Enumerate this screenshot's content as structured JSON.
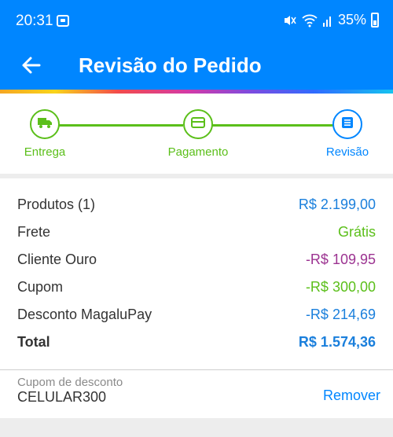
{
  "status_bar": {
    "time": "20:31",
    "battery_percent": "35%",
    "icons": [
      "notification-icon",
      "mute-icon",
      "wifi-icon",
      "signal-icon",
      "battery-icon"
    ]
  },
  "app_bar": {
    "title": "Revisão do Pedido",
    "back_icon": "arrow-left-icon"
  },
  "colors": {
    "primary": "#0086ff",
    "green": "#5bbf1a",
    "purple": "#9c3391",
    "text": "#333333"
  },
  "stepper": {
    "steps": [
      {
        "label": "Entrega",
        "icon": "truck-icon",
        "state": "done"
      },
      {
        "label": "Pagamento",
        "icon": "card-icon",
        "state": "done"
      },
      {
        "label": "Revisão",
        "icon": "list-icon",
        "state": "active"
      }
    ]
  },
  "summary": {
    "rows": [
      {
        "label": "Produtos (1)",
        "value": "R$ 2.199,00",
        "color": "#1a7fdc"
      },
      {
        "label": "Frete",
        "value": "Grátis",
        "color": "#5bbf1a"
      },
      {
        "label": "Cliente Ouro",
        "value": "-R$ 109,95",
        "color": "#9c3391"
      },
      {
        "label": "Cupom",
        "value": "-R$ 300,00",
        "color": "#5bbf1a"
      },
      {
        "label": "Desconto MagaluPay",
        "value": "-R$ 214,69",
        "color": "#1a7fdc"
      }
    ],
    "total": {
      "label": "Total",
      "value": "R$ 1.574,36",
      "color": "#1a7fdc"
    }
  },
  "coupon": {
    "label": "Cupom de desconto",
    "code": "CELULAR300",
    "remove_label": "Remover"
  }
}
